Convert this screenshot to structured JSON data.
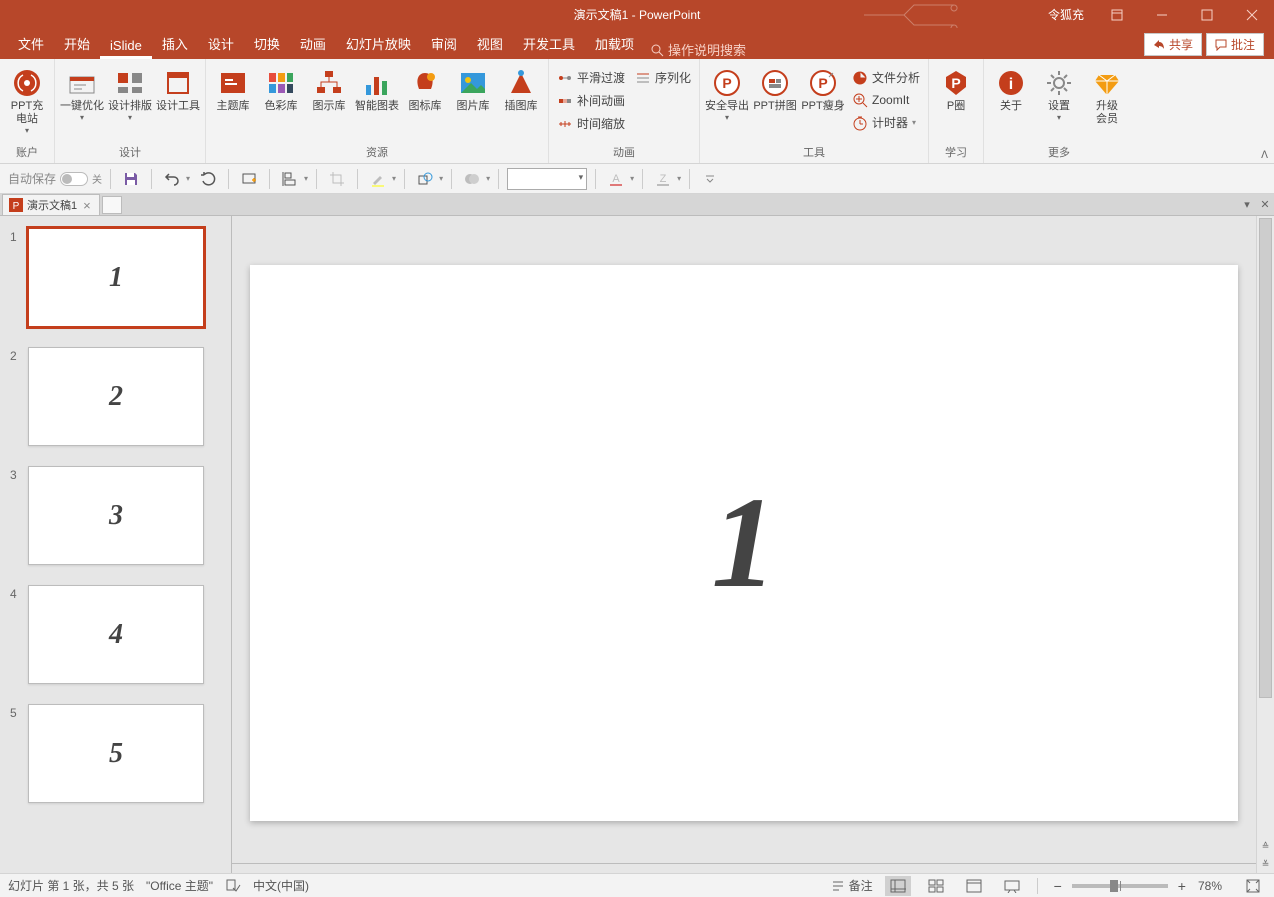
{
  "title": "演示文稿1  -  PowerPoint",
  "user": "令狐充",
  "menu": {
    "items": [
      "文件",
      "开始",
      "iSlide",
      "插入",
      "设计",
      "切换",
      "动画",
      "幻灯片放映",
      "审阅",
      "视图",
      "开发工具",
      "加载项"
    ],
    "active": "iSlide",
    "search_placeholder": "操作说明搜索",
    "share": "共享",
    "comment": "批注"
  },
  "ribbon": {
    "groups": [
      {
        "label": "账户",
        "items_big": [
          {
            "k": "ppt_cdz",
            "t1": "PPT充",
            "t2": "电站",
            "dd": true
          }
        ]
      },
      {
        "label": "设计",
        "items_big": [
          {
            "k": "yjyh",
            "t1": "一键优化",
            "dd": true
          },
          {
            "k": "sjpb",
            "t1": "设计排版",
            "dd": true
          },
          {
            "k": "sjgj",
            "t1": "设计工具"
          }
        ]
      },
      {
        "label": "资源",
        "items_big": [
          {
            "k": "ztk",
            "t1": "主题库"
          },
          {
            "k": "seck",
            "t1": "色彩库"
          },
          {
            "k": "txk",
            "t1": "图示库"
          },
          {
            "k": "zntb",
            "t1": "智能图表"
          },
          {
            "k": "tbk",
            "t1": "图标库"
          },
          {
            "k": "tpk",
            "t1": "图片库"
          },
          {
            "k": "ctk",
            "t1": "插图库"
          }
        ]
      },
      {
        "label": "动画",
        "items_small": [
          {
            "k": "phgd",
            "t": "平滑过渡"
          },
          {
            "k": "bjdh",
            "t": "补间动画"
          },
          {
            "k": "sjsf",
            "t": "时间缩放"
          },
          {
            "k": "xlh",
            "t": "序列化"
          }
        ]
      },
      {
        "label": "工具",
        "items_big": [
          {
            "k": "aqdc",
            "t1": "安全导出",
            "dd": true
          },
          {
            "k": "pptpj",
            "t1": "PPT拼图"
          },
          {
            "k": "pptss",
            "t1": "PPT瘦身"
          }
        ],
        "items_small": [
          {
            "k": "wjfx",
            "t": "文件分析"
          },
          {
            "k": "zoomit",
            "t": "ZoomIt"
          },
          {
            "k": "jsq",
            "t": "计时器",
            "dd": true
          }
        ]
      },
      {
        "label": "学习",
        "items_big": [
          {
            "k": "pq",
            "t1": "P圈"
          }
        ]
      },
      {
        "label": "更多",
        "items_big": [
          {
            "k": "gy",
            "t1": "关于"
          },
          {
            "k": "sz",
            "t1": "设置",
            "dd": true
          },
          {
            "k": "sjhy",
            "t1": "升级",
            "t2": "会员"
          }
        ]
      }
    ],
    "collapse": "▲"
  },
  "qat": {
    "autosave": "自动保存",
    "autosave_state": "关"
  },
  "doctab": {
    "name": "演示文稿1"
  },
  "slides": [
    {
      "n": "1",
      "content": "1",
      "selected": true
    },
    {
      "n": "2",
      "content": "2"
    },
    {
      "n": "3",
      "content": "3"
    },
    {
      "n": "4",
      "content": "4"
    },
    {
      "n": "5",
      "content": "5"
    }
  ],
  "current_slide_content": "1",
  "status": {
    "pos": "幻灯片 第 1 张，共 5 张",
    "theme": "\"Office 主题\"",
    "lang": "中文(中国)",
    "notes": "备注",
    "zoom": "78%"
  }
}
